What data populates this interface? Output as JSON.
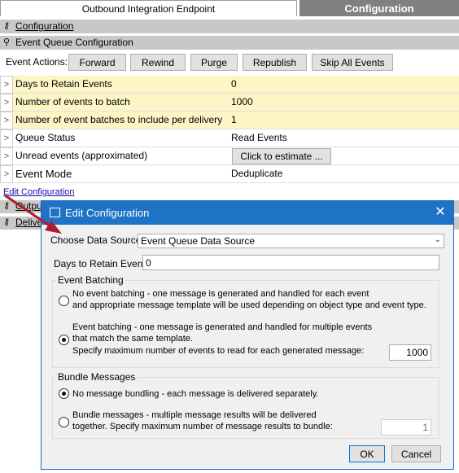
{
  "tabs": {
    "endpoint": "Outbound Integration Endpoint",
    "configuration": "Configuration"
  },
  "sections": {
    "configuration": "Configuration",
    "event_queue": "Event Queue Configuration",
    "output": "Outpu",
    "delivery": "Deliver"
  },
  "event_actions": {
    "label": "Event Actions:",
    "buttons": [
      "Forward",
      "Rewind",
      "Purge",
      "Republish",
      "Skip All Events"
    ]
  },
  "config_rows": [
    {
      "label": "Days to Retain Events",
      "value": "0"
    },
    {
      "label": "Number of events to batch",
      "value": "1000"
    },
    {
      "label": "Number of event batches to include per delivery",
      "value": "1"
    },
    {
      "label": "Queue Status",
      "value": "Read Events"
    },
    {
      "label": "Unread events (approximated)",
      "value": "Click to estimate ..."
    },
    {
      "label": "Event Mode",
      "value": "Deduplicate"
    }
  ],
  "edit_link": "Edit Configuration",
  "dialog": {
    "title": "Edit Configuration",
    "close_glyph": "✕",
    "data_source_label": "Choose Data Source",
    "data_source_value": "Event Queue Data Source",
    "days_label": "Days to Retain Events",
    "days_value": "0",
    "event_batching": {
      "legend": "Event Batching",
      "option1_line1": "No event batching - one message is generated and handled for each event",
      "option1_line2": "and appropriate message template will be used depending on object type and event type.",
      "option2_line1": "Event batching - one message is generated and handled for multiple events",
      "option2_line2": "that match the same template.",
      "option2_line3": "Specify maximum number of events to read for each generated message:",
      "max_events": "1000",
      "selected": "option2"
    },
    "bundle_messages": {
      "legend": "Bundle Messages",
      "option1": "No message bundling - each message is delivered separately.",
      "option2_line1": "Bundle messages - multiple message results will be delivered",
      "option2_line2": "together. Specify maximum number of message results to bundle:",
      "max_bundle": "1",
      "selected": "option1"
    },
    "ok_label": "OK",
    "cancel_label": "Cancel"
  },
  "colors": {
    "title_bar": "#1e73c6",
    "yellow_cell": "#fdf5c6",
    "section_bar": "#c8c8c8",
    "annotation_arrow": "#b01c2e"
  }
}
